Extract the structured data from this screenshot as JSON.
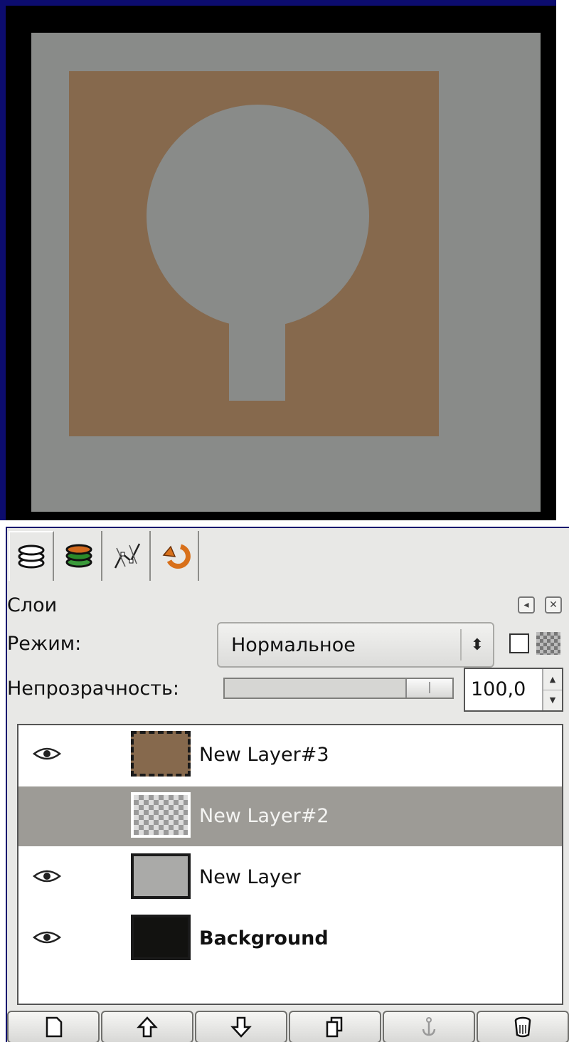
{
  "canvas": {
    "colors": {
      "frame": "#000000",
      "background": "#898b89",
      "layer_fill": "#86694d"
    }
  },
  "dock": {
    "tabs": [
      {
        "icon": "layers-icon"
      },
      {
        "icon": "channels-icon"
      },
      {
        "icon": "paths-icon"
      },
      {
        "icon": "undo-history-icon"
      }
    ],
    "title": "Слои",
    "header_buttons": [
      {
        "icon": "menu-arrow-icon"
      },
      {
        "icon": "close-icon"
      }
    ],
    "mode": {
      "label": "Режим:",
      "value": "Нормальное"
    },
    "opacity": {
      "label": "Непрозрачность:",
      "value": "100,0",
      "percent": 100
    },
    "layers": [
      {
        "name": "New Layer#3",
        "visible": true,
        "selected": false,
        "bold": false
      },
      {
        "name": "New Layer#2",
        "visible": false,
        "selected": true,
        "bold": false
      },
      {
        "name": "New Layer",
        "visible": true,
        "selected": false,
        "bold": false
      },
      {
        "name": "Background",
        "visible": true,
        "selected": false,
        "bold": true
      }
    ],
    "buttons": [
      {
        "icon": "new-layer-icon"
      },
      {
        "icon": "raise-layer-icon"
      },
      {
        "icon": "lower-layer-icon"
      },
      {
        "icon": "duplicate-layer-icon"
      },
      {
        "icon": "anchor-layer-icon"
      },
      {
        "icon": "delete-layer-icon"
      }
    ]
  }
}
